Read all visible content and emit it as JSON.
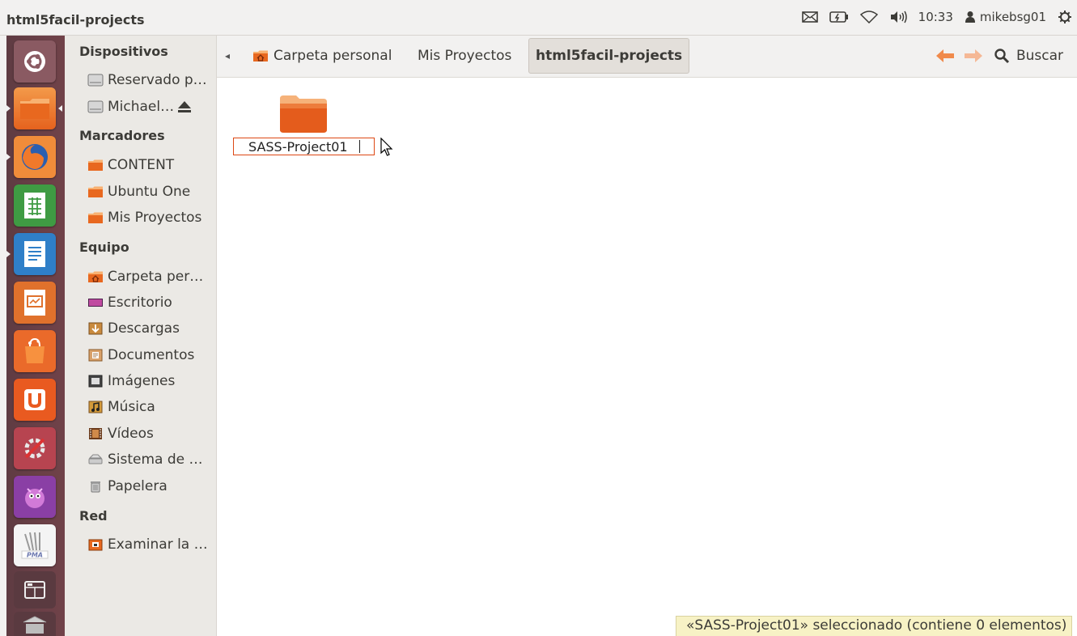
{
  "window": {
    "title": "html5facil-projects"
  },
  "panel": {
    "time": "10:33",
    "user": "mikebsg01"
  },
  "launcher": {
    "apps": [
      "dash-home",
      "files",
      "firefox",
      "libreoffice-calc",
      "libreoffice-writer",
      "libreoffice-impress",
      "software-center",
      "ubuntu-one",
      "system-settings",
      "pidgin",
      "phpmyadmin",
      "workspace-switcher",
      "trash"
    ]
  },
  "sidebar": {
    "sections": [
      {
        "header": "Dispositivos",
        "items": [
          {
            "label": "Reservado p…",
            "icon": "drive-icon"
          },
          {
            "label": "Michael…",
            "icon": "drive-icon",
            "eject": true
          }
        ]
      },
      {
        "header": "Marcadores",
        "items": [
          {
            "label": "CONTENT",
            "icon": "folder-icon"
          },
          {
            "label": "Ubuntu One",
            "icon": "folder-icon"
          },
          {
            "label": "Mis Proyectos",
            "icon": "folder-icon"
          }
        ]
      },
      {
        "header": "Equipo",
        "items": [
          {
            "label": "Carpeta per…",
            "icon": "home-folder-icon"
          },
          {
            "label": "Escritorio",
            "icon": "desktop-icon"
          },
          {
            "label": "Descargas",
            "icon": "downloads-icon"
          },
          {
            "label": "Documentos",
            "icon": "documents-icon"
          },
          {
            "label": "Imágenes",
            "icon": "pictures-icon"
          },
          {
            "label": "Música",
            "icon": "music-icon"
          },
          {
            "label": "Vídeos",
            "icon": "videos-icon"
          },
          {
            "label": "Sistema de …",
            "icon": "filesystem-icon"
          },
          {
            "label": "Papelera",
            "icon": "trash-icon"
          }
        ]
      },
      {
        "header": "Red",
        "items": [
          {
            "label": "Examinar la …",
            "icon": "network-icon"
          }
        ]
      }
    ]
  },
  "pathbar": {
    "crumbs": [
      {
        "label": "Carpeta personal"
      },
      {
        "label": "Mis Proyectos"
      },
      {
        "label": "html5facil-projects"
      }
    ],
    "search_label": "Buscar"
  },
  "main": {
    "folder_name": "SASS-Project01"
  },
  "status": {
    "text": "«SASS-Project01» seleccionado (contiene 0 elementos)"
  },
  "colors": {
    "accent": "#dd4814",
    "launcher_bg": "#6a4047",
    "status_bg": "#f7f2c5"
  }
}
